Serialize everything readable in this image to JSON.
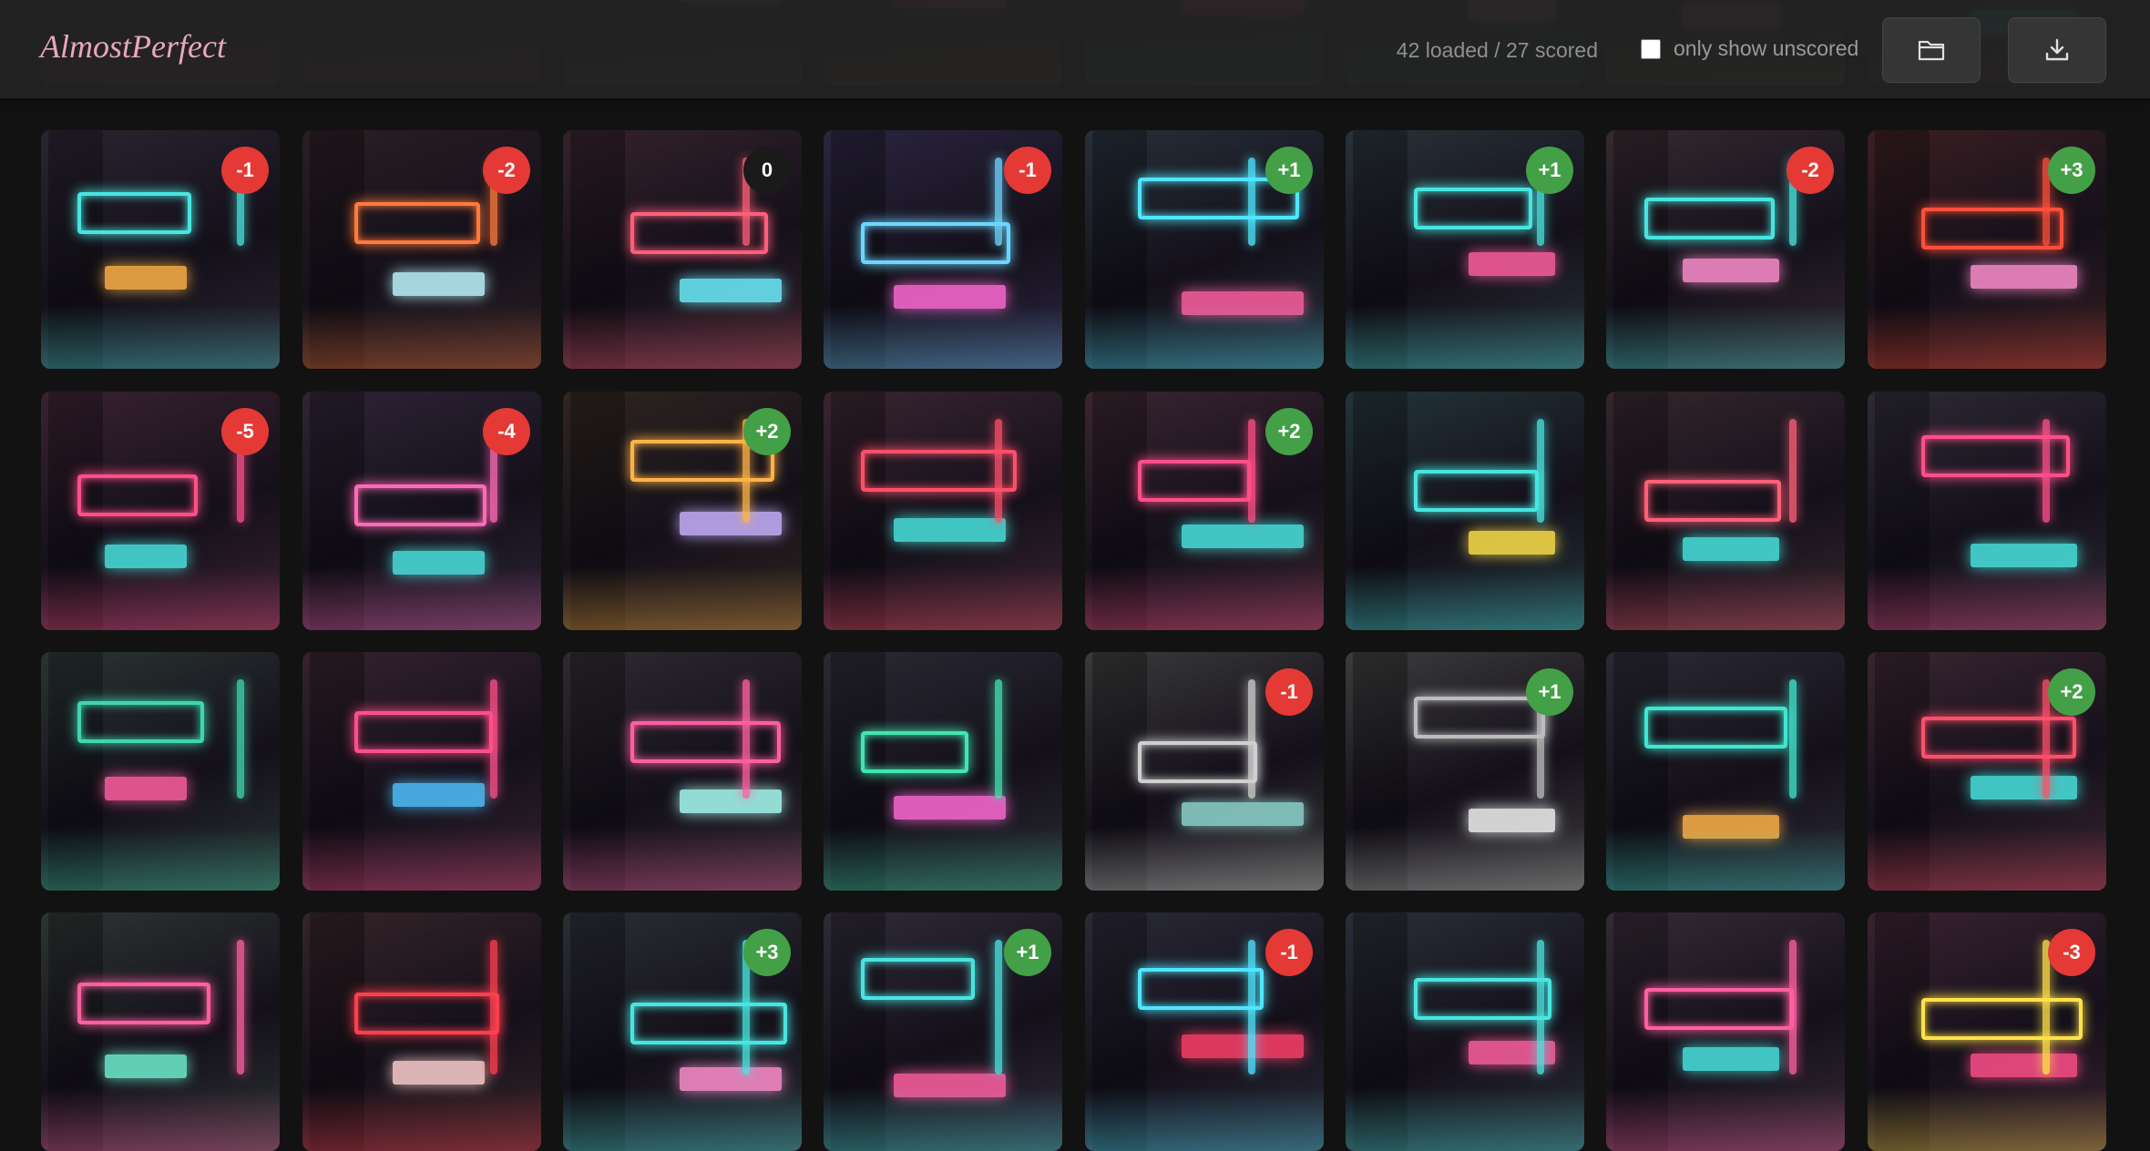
{
  "app": {
    "title": "AlmostPerfect"
  },
  "status": {
    "text": "42 loaded / 27 scored"
  },
  "filter": {
    "label": "only show unscored",
    "checked": false
  },
  "buttons": {
    "folder_icon": "folder-icon",
    "download_icon": "download-icon"
  },
  "colors": {
    "positive": "#43a047",
    "negative": "#e53935",
    "neutral": "#1a1a1a",
    "brand": "#e9a6bf"
  },
  "rows": [
    {
      "tiles": [
        {
          "score": null,
          "tone": "#3a2433",
          "sign": "#ff5fa2",
          "sign2": "#48e5e0"
        },
        {
          "score": null,
          "tone": "#2d1f36",
          "sign": "#ff4f8a",
          "sign2": "#ffcf5a"
        },
        {
          "score": null,
          "tone": "#302733",
          "sign": "#ff8fcf",
          "sign2": "#6df0ff"
        },
        {
          "score": null,
          "tone": "#3a2a2a",
          "sign": "#ffb347",
          "sign2": "#ff4f8a"
        },
        {
          "score": null,
          "tone": "#26303a",
          "sign": "#6df0ff",
          "sign2": "#ff5fa2"
        },
        {
          "score": null,
          "tone": "#2a3038",
          "sign": "#48e5e0",
          "sign2": "#ff8fcf"
        },
        {
          "score": null,
          "tone": "#382a35",
          "sign": "#d6ff5a",
          "sign2": "#ff5fa2"
        },
        {
          "score": null,
          "tone": "#332430",
          "sign": "#ff4f8a",
          "sign2": "#48e5e0"
        }
      ]
    },
    {
      "tiles": [
        {
          "score": "-1",
          "tone": "#2a2430",
          "sign": "#48e5e0",
          "sign2": "#ffb347"
        },
        {
          "score": "-2",
          "tone": "#2a1f24",
          "sign": "#ff7a3d",
          "sign2": "#bff7ff"
        },
        {
          "score": "0",
          "tone": "#35222b",
          "sign": "#ff5f7a",
          "sign2": "#6df0ff"
        },
        {
          "score": "-1",
          "tone": "#2b2540",
          "sign": "#6dd6ff",
          "sign2": "#ff6ad5"
        },
        {
          "score": "+1",
          "tone": "#26303a",
          "sign": "#4fe6ff",
          "sign2": "#ff5fa2"
        },
        {
          "score": "+1",
          "tone": "#283238",
          "sign": "#48e5e0",
          "sign2": "#ff5fa2"
        },
        {
          "score": "-2",
          "tone": "#352a30",
          "sign": "#48e5e0",
          "sign2": "#ff8fcf"
        },
        {
          "score": "+3",
          "tone": "#3a1f22",
          "sign": "#ff4f3a",
          "sign2": "#ff8fcf"
        }
      ]
    },
    {
      "tiles": [
        {
          "score": "-5",
          "tone": "#3a2230",
          "sign": "#ff4f8a",
          "sign2": "#48e5e0"
        },
        {
          "score": "-4",
          "tone": "#2e2436",
          "sign": "#ff6ab8",
          "sign2": "#48e5e0"
        },
        {
          "score": "+2",
          "tone": "#2f2520",
          "sign": "#ffb347",
          "sign2": "#c9b3ff"
        },
        {
          "score": null,
          "tone": "#3a2530",
          "sign": "#ff4f6a",
          "sign2": "#48e5e0"
        },
        {
          "score": "+2",
          "tone": "#3a2530",
          "sign": "#ff4f8a",
          "sign2": "#48e5e0"
        },
        {
          "score": null,
          "tone": "#23343a",
          "sign": "#48e5e0",
          "sign2": "#ffe14a"
        },
        {
          "score": null,
          "tone": "#35262d",
          "sign": "#ff5f7a",
          "sign2": "#48e5e0"
        },
        {
          "score": null,
          "tone": "#2e2a35",
          "sign": "#ff4f8a",
          "sign2": "#48e5e0"
        }
      ]
    },
    {
      "tiles": [
        {
          "score": null,
          "tone": "#2a3432",
          "sign": "#3fd6b0",
          "sign2": "#ff5fa2"
        },
        {
          "score": null,
          "tone": "#35222e",
          "sign": "#ff4f8a",
          "sign2": "#4fc3ff"
        },
        {
          "score": null,
          "tone": "#2f2a30",
          "sign": "#ff5fa2",
          "sign2": "#a8fff5"
        },
        {
          "score": null,
          "tone": "#2a2a33",
          "sign": "#3fe6b0",
          "sign2": "#ff6ad5"
        },
        {
          "score": "-1",
          "tone": "#3a3a3a",
          "sign": "#d0d0d0",
          "sign2": "#8fd6d0"
        },
        {
          "score": "+1",
          "tone": "#3c3c3c",
          "sign": "#bdbdbd",
          "sign2": "#f2f2f2"
        },
        {
          "score": null,
          "tone": "#2b2a35",
          "sign": "#3fe6d0",
          "sign2": "#ffb347"
        },
        {
          "score": "+2",
          "tone": "#3a2530",
          "sign": "#ff4f6a",
          "sign2": "#48e5e0"
        }
      ]
    },
    {
      "tiles": [
        {
          "score": null,
          "tone": "#2d3432",
          "sign": "#ff5fa2",
          "sign2": "#6df0d0"
        },
        {
          "score": null,
          "tone": "#352428",
          "sign": "#ff3f4f",
          "sign2": "#ffd0d0"
        },
        {
          "score": "+3",
          "tone": "#2a2e35",
          "sign": "#48e5e0",
          "sign2": "#ff8fcf"
        },
        {
          "score": "+1",
          "tone": "#2e2a38",
          "sign": "#48e5e0",
          "sign2": "#ff5fa2"
        },
        {
          "score": "-1",
          "tone": "#2a2a38",
          "sign": "#4fe6ff",
          "sign2": "#ff3f6a"
        },
        {
          "score": null,
          "tone": "#2a2e38",
          "sign": "#48e5e0",
          "sign2": "#ff5fa2"
        },
        {
          "score": null,
          "tone": "#352a35",
          "sign": "#ff5fa2",
          "sign2": "#48e5e0"
        },
        {
          "score": "-3",
          "tone": "#3a2230",
          "sign": "#ffe14a",
          "sign2": "#ff4f8a"
        }
      ]
    }
  ]
}
